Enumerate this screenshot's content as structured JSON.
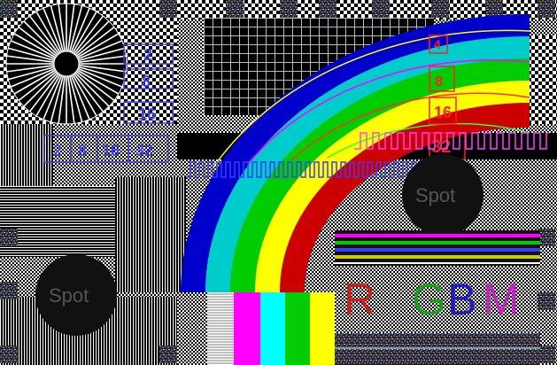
{
  "spot_labels": [
    "Spot",
    "Spot"
  ],
  "blue_numbers_vertical": [
    "2",
    "8",
    "16"
  ],
  "blue_numbers_horizontal": [
    "2",
    "8",
    "16",
    "32"
  ],
  "red_numbers": [
    "4",
    "8",
    "16",
    "32"
  ],
  "rgbm": {
    "letters": [
      "R",
      "G",
      "B",
      "M"
    ],
    "colors": [
      "#c81e1e",
      "#19a019",
      "#1e1ec8",
      "#c81ec8"
    ]
  },
  "palette": {
    "arc_bands": [
      "#0000cc",
      "#00cccc",
      "#00cc00",
      "#ffff00",
      "#cc0000"
    ],
    "bars": [
      "#000000",
      "#ffffff",
      "#ffff00",
      "#00ffff",
      "#00ff00",
      "#ff00ff",
      "#ff0000",
      "#0000ff"
    ]
  }
}
